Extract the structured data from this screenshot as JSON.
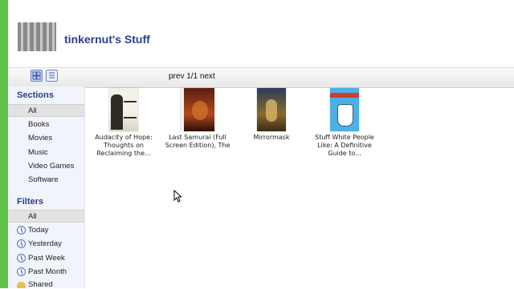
{
  "header": {
    "title": "tinkernut's Stuff"
  },
  "toolbar": {
    "grid_view_icon": "grid-view-icon",
    "list_view_icon": "list-view-icon",
    "pager": {
      "prev": "prev",
      "pages": "1/1",
      "next": "next"
    }
  },
  "sidebar": {
    "sections_heading": "Sections",
    "sections": [
      "All",
      "Books",
      "Movies",
      "Music",
      "Video Games",
      "Software"
    ],
    "selected_section": "All",
    "filters_heading": "Filters",
    "filters": [
      {
        "label": "All",
        "icon": ""
      },
      {
        "label": "Today",
        "icon": "clock-icon"
      },
      {
        "label": "Yesterday",
        "icon": "clock-icon"
      },
      {
        "label": "Past Week",
        "icon": "clock-icon"
      },
      {
        "label": "Past Month",
        "icon": "clock-icon"
      },
      {
        "label": "Shared",
        "icon": "shared-icon"
      }
    ]
  },
  "items": [
    {
      "line1": "Audacity of Hope:",
      "line2": "Thoughts on",
      "line3": "Reclaiming the..."
    },
    {
      "line1": "Last Samurai (Full",
      "line2": "Screen Edition), The",
      "line3": ""
    },
    {
      "line1": "Mirrormask",
      "line2": "",
      "line3": ""
    },
    {
      "line1": "Stuff White People",
      "line2": "Like: A Definitive",
      "line3": "Guide to..."
    }
  ],
  "colors": {
    "accent": "#2a3f8f",
    "side_bar": "#5fc24a",
    "link": "#5a73c6"
  }
}
